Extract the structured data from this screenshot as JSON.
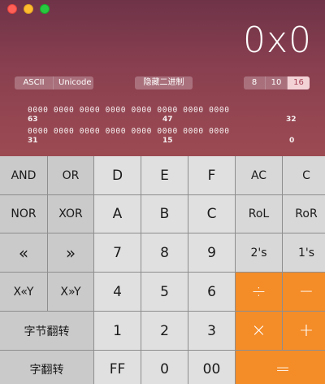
{
  "display": {
    "value": "0x0"
  },
  "encoding": {
    "options": [
      "ASCII",
      "Unicode"
    ]
  },
  "hide_binary": {
    "label": "隐藏二进制"
  },
  "base": {
    "options": [
      "8",
      "10",
      "16"
    ],
    "selected": "16"
  },
  "bits": {
    "row1": "0000 0000 0000 0000 0000 0000 0000 0000",
    "row2": "0000 0000 0000 0000 0000 0000 0000 0000",
    "idx_63": "63",
    "idx_47": "47",
    "idx_32": "32",
    "idx_31": "31",
    "idx_15": "15",
    "idx_0": "0"
  },
  "keys": {
    "and": "AND",
    "or": "OR",
    "d": "D",
    "e": "E",
    "f": "F",
    "ac": "AC",
    "c": "C",
    "nor": "NOR",
    "xor": "XOR",
    "a": "A",
    "b": "B",
    "c_hex": "C",
    "rol": "RoL",
    "ror": "RoR",
    "shl": "«",
    "shr": "»",
    "n7": "7",
    "n8": "8",
    "n9": "9",
    "twos": "2's",
    "ones": "1's",
    "xshly": "X«Y",
    "xshry": "X»Y",
    "n4": "4",
    "n5": "5",
    "n6": "6",
    "div": "÷",
    "minus": "−",
    "byteflip": "字节翻转",
    "n1": "1",
    "n2": "2",
    "n3": "3",
    "mul": "×",
    "plus": "+",
    "wordflip": "字翻转",
    "ff": "FF",
    "n0": "0",
    "n00": "00",
    "eq": "="
  },
  "colors": {
    "accent": "#f48c28",
    "top": "#8a4050"
  }
}
